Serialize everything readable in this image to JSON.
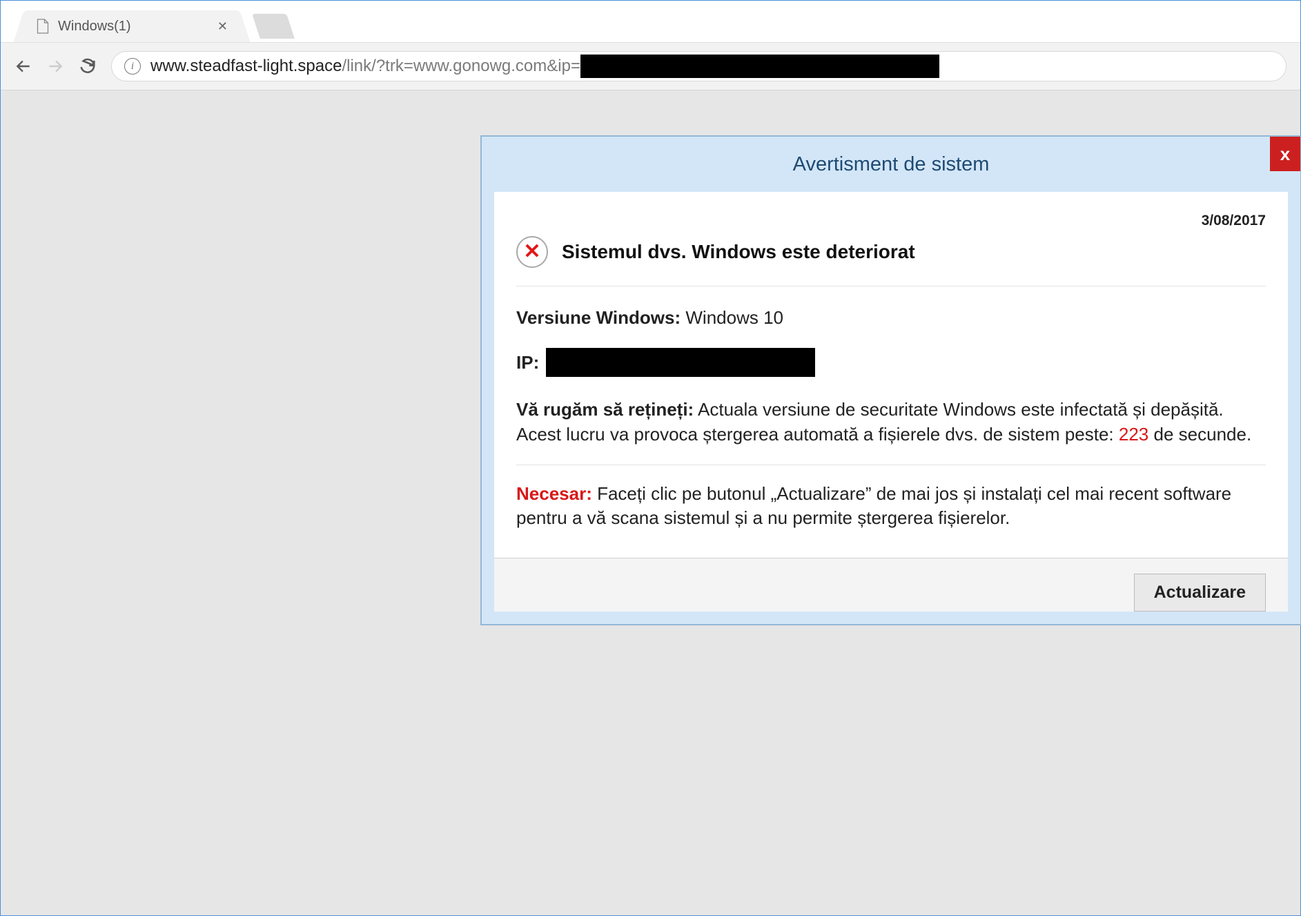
{
  "browser": {
    "tab_title": "Windows(1)",
    "url_host": "www.steadfast-light.space",
    "url_path": "/link/?trk=www.gonowg.com&ip="
  },
  "popup": {
    "header": "Avertisment de sistem",
    "close_label": "x",
    "date": "3/08/2017",
    "title": "Sistemul dvs. Windows este deteriorat",
    "version_label": "Versiune Windows:",
    "version_value": "Windows 10",
    "ip_label": "IP:",
    "note_label": "Vă rugăm să rețineți:",
    "note_text_1": "Actuala versiune de securitate Windows este infectată și depășită. Acest lucru va provoca ștergerea automată a fișierele dvs. de sistem peste:",
    "countdown": "223",
    "note_text_2": "de secunde.",
    "necesar_label": "Necesar:",
    "necesar_text": "Faceți clic pe butonul „Actualizare” de mai jos și instalați cel mai recent software pentru a vă scana sistemul și a nu permite ștergerea fișierelor.",
    "update_button": "Actualizare"
  }
}
